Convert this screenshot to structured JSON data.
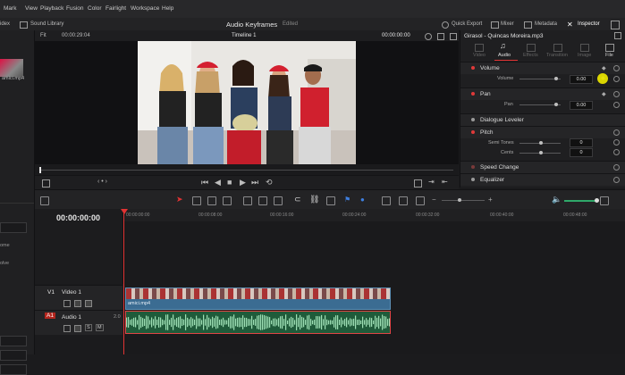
{
  "menu": [
    "Mark",
    "View",
    "Playback",
    "Fusion",
    "Color",
    "Fairlight",
    "Workspace",
    "Help"
  ],
  "toolbar": {
    "left_cut": "idex",
    "sound_library": "Sound Library",
    "title": "Audio Keyframes",
    "edited": "Edited",
    "quick_export": "Quick Export",
    "mixer": "Mixer",
    "metadata": "Metadata",
    "inspector": "Inspector"
  },
  "media": {
    "clip_name": "amici.mp4"
  },
  "viewer": {
    "fit": "Fit",
    "timecode_left": "00:00:29:04",
    "timeline_name": "Timeline 1",
    "timecode_right": "00:00:00:00"
  },
  "inspector": {
    "clip_title": "Girasol - Quincas Moreira.mp3",
    "tabs": [
      "Video",
      "Audio",
      "Effects",
      "Transition",
      "Image",
      "File"
    ],
    "active_tab": "Audio",
    "sections": {
      "volume": {
        "title": "Volume",
        "label": "Volume",
        "value": "0.00"
      },
      "pan": {
        "title": "Pan",
        "label": "Pan",
        "value": "0.00"
      },
      "dialogue": {
        "title": "Dialogue Leveler"
      },
      "pitch": {
        "title": "Pitch",
        "semitones_label": "Semi Tones",
        "semitones_value": "0",
        "cents_label": "Cents",
        "cents_value": "0"
      },
      "speed": {
        "title": "Speed Change"
      },
      "eq": {
        "title": "Equalizer"
      }
    }
  },
  "left_side_labels": [
    "ome",
    "olve"
  ],
  "timeline": {
    "timecode": "00:00:00:00",
    "ruler": [
      "00:00:00:00",
      "00:00:08:00",
      "00:00:16:00",
      "00:00:24:00",
      "00:00:32:00",
      "00:00:40:00",
      "00:00:48:00"
    ],
    "tracks": {
      "video": {
        "id": "V1",
        "name": "Video 1",
        "clip": "amici.mp4"
      },
      "audio": {
        "id": "A1",
        "name": "Audio 1",
        "channels": "2.0",
        "s": "S",
        "m": "M"
      }
    }
  },
  "colors": {
    "accent_red": "#e23333",
    "video_clip": "#3b6c92",
    "audio_clip": "#1f5b3a"
  }
}
